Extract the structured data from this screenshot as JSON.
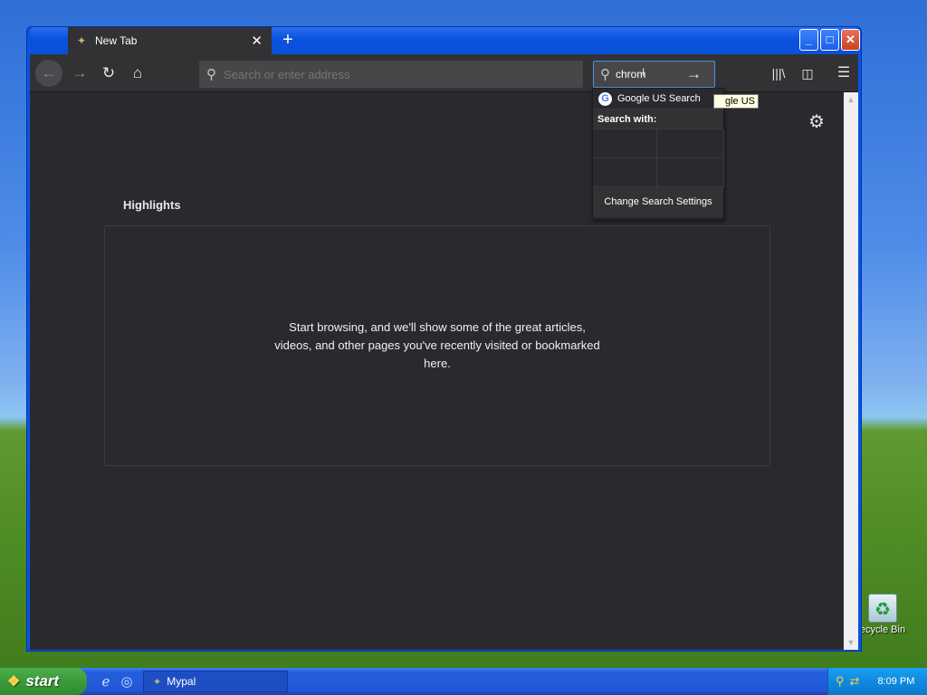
{
  "desktop": {
    "recycle_label": "ecycle Bin"
  },
  "browser": {
    "tab_title": "New Tab",
    "tab_close": "✕",
    "new_tab": "+",
    "window_controls": {
      "minimize": "_",
      "maximize": "□",
      "close": "✕"
    },
    "urlbar_placeholder": "Search or enter address",
    "search_value": "chrom",
    "dropdown": {
      "engine_label": "Google US Search",
      "search_with_label": "Search with:",
      "change_settings_label": "Change Search Settings"
    },
    "tooltip": "gle US",
    "highlights_title": "Highlights",
    "highlights_empty": "Start browsing, and we'll show some of the great articles, videos, and other pages you've recently visited or bookmarked here.",
    "icons": {
      "back": "back-arrow-icon",
      "forward": "forward-arrow-icon",
      "reload": "reload-icon",
      "home": "home-icon",
      "library": "library-icon",
      "sidebar": "sidebar-icon",
      "menu": "hamburger-menu-icon",
      "settings": "gear-icon"
    }
  },
  "taskbar": {
    "start_label": "start",
    "task_label": "Mypal",
    "clock": "8:09 PM"
  },
  "colors": {
    "content_bg": "#2a2a2e",
    "toolbar_bg": "#323234",
    "xp_blue": "#0a54e0",
    "start_green": "#3c9a3c"
  }
}
